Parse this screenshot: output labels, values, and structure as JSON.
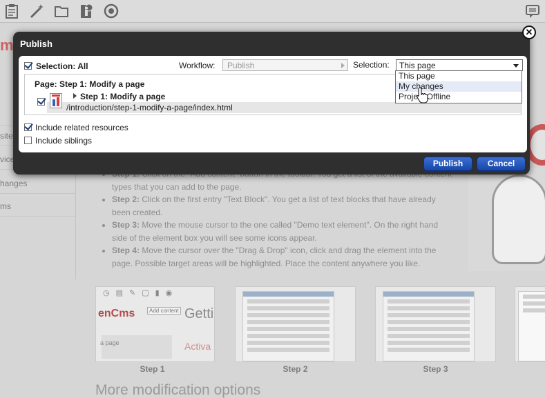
{
  "toolbar": {
    "icons": [
      "clipboard-icon",
      "magic-wand-icon",
      "folder-icon",
      "info-page-icon",
      "target-icon",
      "chat-icon"
    ]
  },
  "background": {
    "logo_text": "m",
    "side_nav": [
      "site",
      "vice",
      "hanges",
      "ms"
    ],
    "steps": [
      {
        "label": "Step 1:",
        "text": " Click on the \"Add content\" button in the toolbar. You get a list of the available content types that you can add to the page."
      },
      {
        "label": "Step 2:",
        "text": " Click on the first entry \"Text Block\". You get a list of text blocks that have already been created."
      },
      {
        "label": "Step 3:",
        "text": " Move the mouse cursor to the one called \"Demo text element\". On the right hand side of the element box you will see some icons appear."
      },
      {
        "label": "Step 4:",
        "text": " Move the cursor over the \"Drag & Drop\" icon, click and drag the element into the page. Possible target areas will be highlighted. Place the content anywhere you like."
      }
    ],
    "thumb1": {
      "logo": "enCms",
      "heading": "Getti",
      "tooltip": "Add content",
      "page_text": "a page",
      "active_text": "Activa"
    },
    "thumb_labels": [
      "Step 1",
      "Step 2",
      "Step 3"
    ],
    "more_options": "More modification options"
  },
  "dialog": {
    "title": "Publish",
    "selection_all": "Selection: All",
    "workflow_label": "Workflow:",
    "workflow_value": "Publish",
    "selection_label": "Selection:",
    "selection_value": "This page",
    "page_title": "Page: Step 1: Modify a page",
    "resource_name": "Step 1: Modify a page",
    "resource_path": "/introduction/step-1-modify-a-page/index.html",
    "include_related": "Include related resources",
    "include_siblings": "Include siblings",
    "dropdown_options": [
      "This page",
      "My changes",
      "Project Offline"
    ],
    "publish_button": "Publish",
    "cancel_button": "Cancel"
  }
}
